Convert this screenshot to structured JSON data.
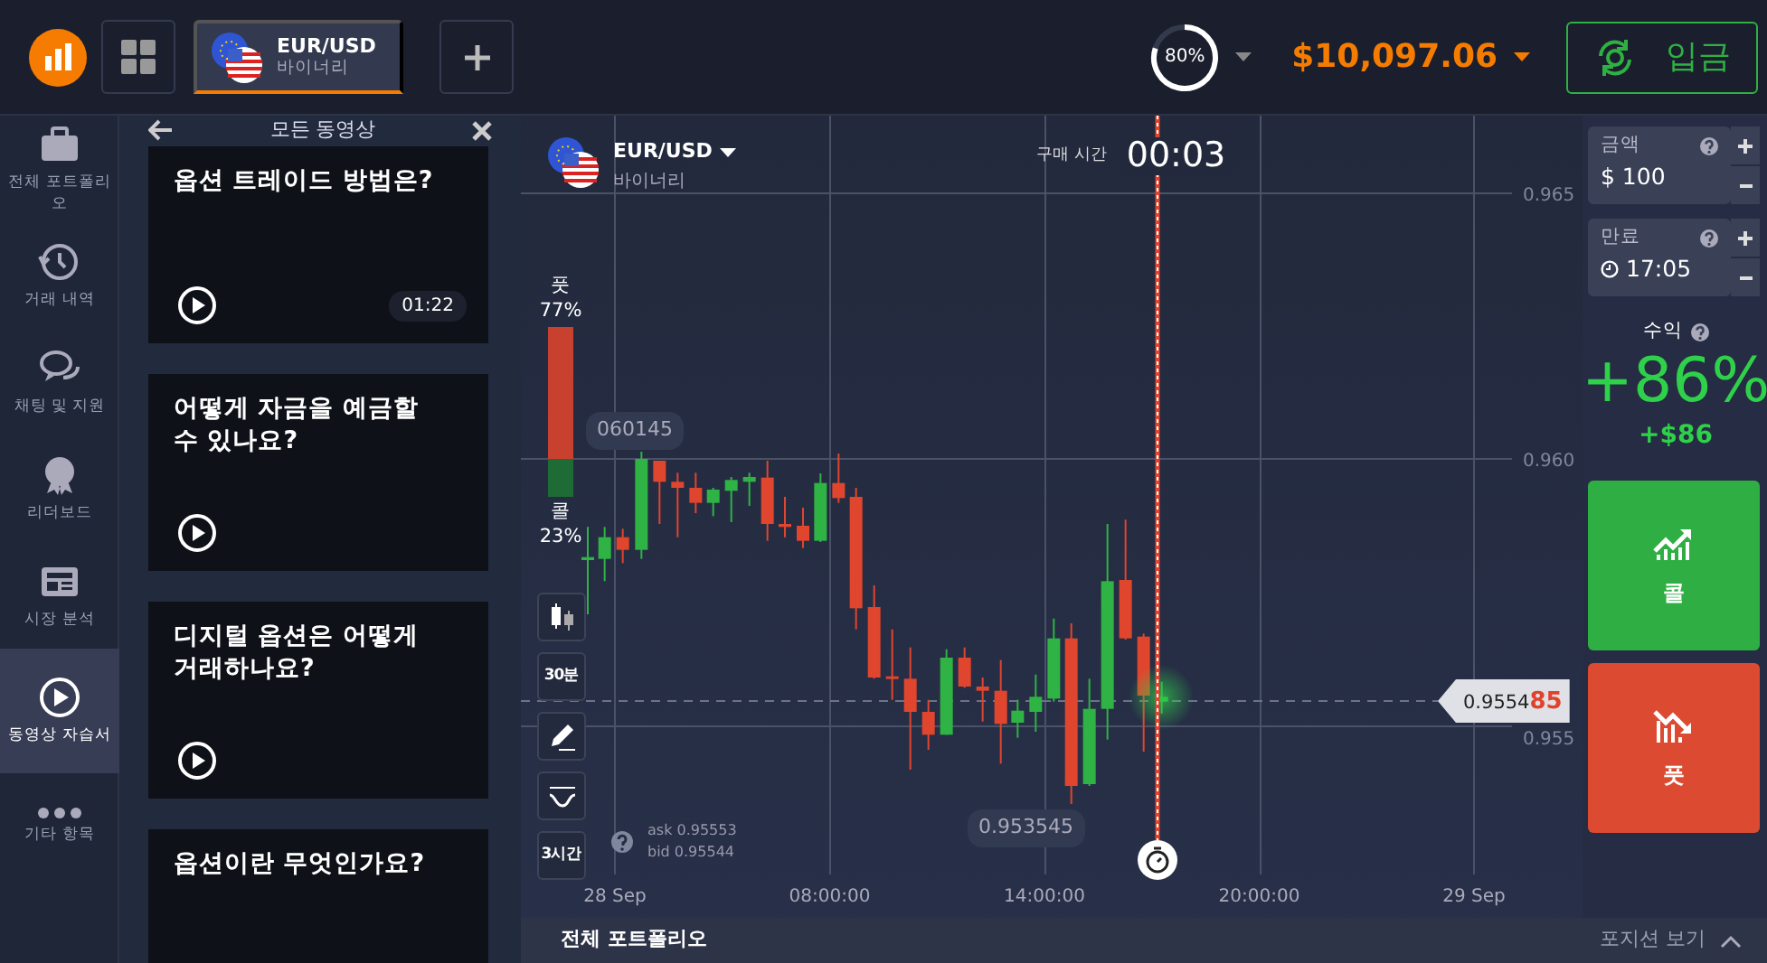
{
  "top_bar": {
    "tabs": [
      {
        "title": "EUR/USD",
        "subtitle": "바이너리",
        "selected": true
      }
    ],
    "progress": {
      "label": "80%",
      "level": 0.8
    },
    "balance": "$10,097.06",
    "deposit_button": "입금"
  },
  "sidebar": {
    "items": [
      {
        "label": "전체 포트폴리오",
        "kind": "portfolio",
        "selected": false
      },
      {
        "label": "거래 내역",
        "kind": "history",
        "selected": false
      },
      {
        "label": "채팅 및 지원",
        "kind": "chat",
        "selected": false
      },
      {
        "label": "리더보드",
        "kind": "leaderboard",
        "selected": false
      },
      {
        "label": "시장 분석",
        "kind": "analysis",
        "selected": false
      },
      {
        "label": "동영상 자습서",
        "kind": "video",
        "selected": true
      },
      {
        "label": "기타 항목",
        "kind": "more",
        "selected": false
      }
    ]
  },
  "video_panel": {
    "title": "모든 동영상",
    "videos": [
      {
        "title": "옵션 트레이드 방법은?",
        "duration": "01:22"
      },
      {
        "title": "어떻게 자금을 예금할 수 있나요?"
      },
      {
        "title": "디지털 옵션은 어떻게 거래하나요?"
      },
      {
        "title": "옵션이란 무엇인가요?"
      }
    ]
  },
  "chart": {
    "asset": {
      "name": "EUR/USD",
      "type": "바이너리"
    },
    "purchase_time_label": "구매 시간",
    "purchase_time": "00:03",
    "sentiment": {
      "put_label": "풋",
      "put_percent": "77%",
      "call_label": "콜",
      "call_percent": "23%",
      "level": 0.77
    },
    "high_bubble": "060145",
    "low_bubble": "0.953545",
    "y_ticks": [
      "0.965",
      "0.960",
      "0.955"
    ],
    "x_ticks": [
      "28 Sep",
      "08:00:00",
      "14:00:00",
      "20:00:00",
      "29 Sep"
    ],
    "current_price": {
      "main": "0.9554",
      "tail": "85"
    },
    "tools": [
      {
        "kind": "chart-type"
      },
      {
        "kind": "timeframe",
        "label": "30분"
      },
      {
        "kind": "draw"
      },
      {
        "kind": "indicator"
      },
      {
        "kind": "timeframe",
        "label": "3시간"
      }
    ],
    "ask": "ask 0.95553",
    "bid": "bid 0.95544"
  },
  "trade_panel": {
    "amount": {
      "label": "금액",
      "value": "$ 100"
    },
    "expiration": {
      "label": "만료",
      "value": "17:05"
    },
    "profit_label": "수익",
    "profit_percent": "+86%",
    "profit_amount": "+$86",
    "call_button": "콜",
    "put_button": "풋"
  },
  "bottom_bar": {
    "portfolio": "전체 포트폴리오",
    "positions": "포지션 보기"
  }
}
